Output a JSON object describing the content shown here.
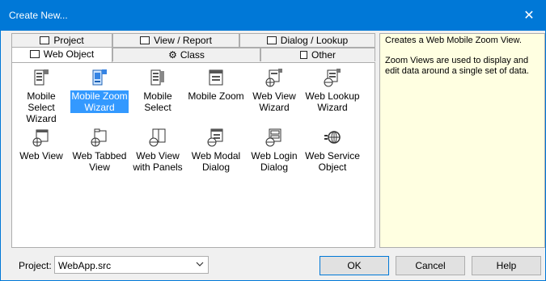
{
  "window": {
    "title": "Create New...",
    "close_glyph": "✕"
  },
  "tabs": {
    "row1": [
      {
        "label": "Project",
        "icon": "window-icon"
      },
      {
        "label": "View / Report",
        "icon": "view-report-icon"
      },
      {
        "label": "Dialog / Lookup",
        "icon": "dialog-lookup-icon"
      }
    ],
    "row2": [
      {
        "label": "Web Object",
        "icon": "web-object-icon",
        "active": true
      },
      {
        "label": "Class",
        "icon": "class-icon"
      },
      {
        "label": "Other",
        "icon": "document-icon"
      }
    ]
  },
  "items": [
    {
      "label": "Mobile Select Wizard",
      "icon": "mobile-select-wizard-icon"
    },
    {
      "label": "Mobile Zoom Wizard",
      "icon": "mobile-zoom-wizard-icon",
      "selected": true
    },
    {
      "label": "Mobile Select",
      "icon": "mobile-select-icon"
    },
    {
      "label": "Mobile Zoom",
      "icon": "mobile-zoom-icon"
    },
    {
      "label": "Web View Wizard",
      "icon": "web-view-wizard-icon"
    },
    {
      "label": "Web Lookup Wizard",
      "icon": "web-lookup-wizard-icon"
    },
    {
      "label": "Web View",
      "icon": "web-view-icon"
    },
    {
      "label": "Web Tabbed View",
      "icon": "web-tabbed-view-icon"
    },
    {
      "label": "Web View with Panels",
      "icon": "web-view-panels-icon"
    },
    {
      "label": "Web Modal Dialog",
      "icon": "web-modal-dialog-icon"
    },
    {
      "label": "Web Login Dialog",
      "icon": "web-login-dialog-icon"
    },
    {
      "label": "Web Service Object",
      "icon": "web-service-object-icon"
    }
  ],
  "description": {
    "line1": "Creates a Web Mobile Zoom View.",
    "line2": "Zoom Views are used to display and edit data around a single set of data."
  },
  "footer": {
    "project_label": "Project:",
    "project_value": "WebApp.src",
    "ok_label": "OK",
    "cancel_label": "Cancel",
    "help_label": "Help"
  },
  "colors": {
    "titlebar": "#0078d7",
    "selection": "#3399ff",
    "description_bg": "#ffffe1"
  }
}
